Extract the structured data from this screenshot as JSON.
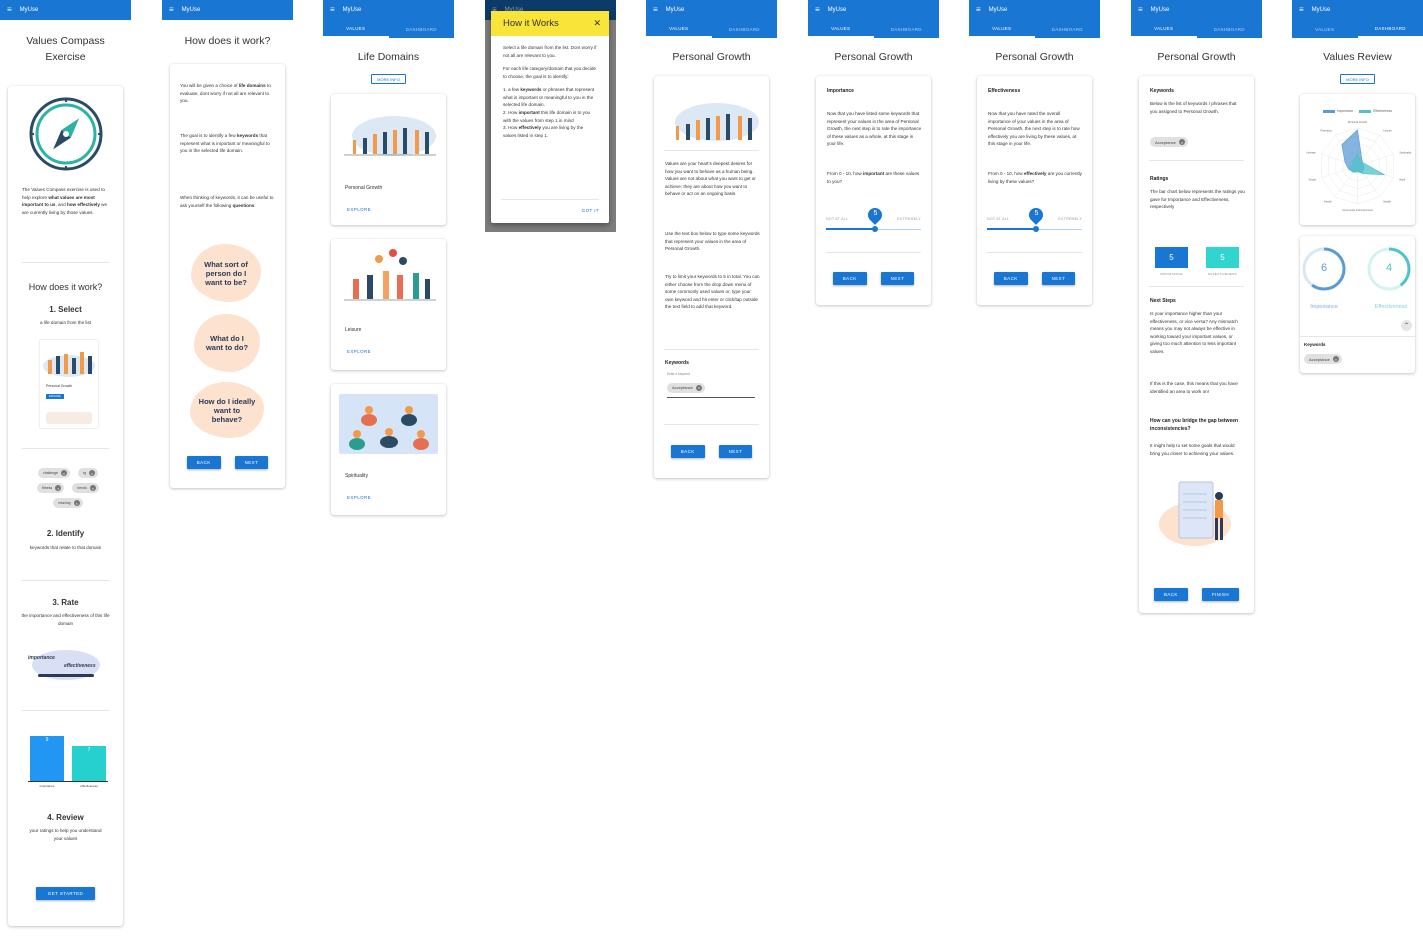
{
  "app": {
    "name": "MyUse",
    "tab_values": "Values",
    "tab_dashboard": "Dashboard"
  },
  "s1": {
    "title": "Values Compass Exercise",
    "intro_a": "The Values Compass exercise is used to help explore ",
    "intro_b": "what values are most important to us",
    "intro_c": ", and ",
    "intro_d": "how effectively",
    "intro_e": " we are currently living by those values.",
    "how_title": "How does it work?",
    "step1_title": "1. Select",
    "step1_text": "a life domain from the list",
    "thumb_label": "Personal Growth",
    "thumb_btn": "EXPLORE",
    "chips": [
      "challenge",
      "rg",
      "fitness",
      "riends",
      "relaxing"
    ],
    "step2_title": "2. Identify",
    "step2_text": "keywords that relate to that domain",
    "step3_title": "3. Rate",
    "step3_text": "the importance and effectiveness of this life domain",
    "scale_importance": "importance",
    "scale_effectiveness": "effectiveness",
    "mini_chart": {
      "bars": [
        {
          "label": "importance",
          "value": 9
        },
        {
          "label": "effectiveness",
          "value": 7
        }
      ]
    },
    "step4_title": "4. Review",
    "step4_text": "your ratings to help you understand your values",
    "get_started": "Get Started"
  },
  "s2": {
    "title": "How does it work?",
    "p1_a": "You will be given a choice of ",
    "p1_b": "life domains",
    "p1_c": " to evaluate, dont worry if not all are relevant to you.",
    "p2_a": "The goal is to identify a few ",
    "p2_b": "keywords",
    "p2_c": " that represent what is important or meaningful to you in the selected life domain.",
    "p3_a": "When thinking of keywords, it can be useful to ask yourself the following ",
    "p3_b": "questions",
    "p3_c": ":",
    "q1": "What sort of person do I want to be?",
    "q2": "What do I want to do?",
    "q3": "How do I ideally want to behave?",
    "back": "Back",
    "next": "Next"
  },
  "s3": {
    "title": "Life Domains",
    "more_info": "More Info",
    "cards": [
      {
        "label": "Personal Growth",
        "action": "Explore"
      },
      {
        "label": "Leisure",
        "action": "Explore"
      },
      {
        "label": "Spirituality",
        "action": "Explore"
      }
    ]
  },
  "s4": {
    "dialog_title": "How it Works",
    "close": "✕",
    "p1": "Select a life domain from the list. Dont worry if not all are relevant to you.",
    "p2": "For each life category/domain that you decide to choose, the goal is to identify:",
    "l1_a": "1. a few ",
    "l1_b": "keywords",
    "l1_c": " or phrases that represent what is important or meaningful to you in the selected life domain.",
    "l2_a": "2. How ",
    "l2_b": "important",
    "l2_c": " this life domain is to you with the values from step 1 in mind",
    "l3_a": "3. How ",
    "l3_b": "effectively",
    "l3_c": " you are living by the values listed in step 1.",
    "got_it": "Got it"
  },
  "s5": {
    "title": "Personal Growth",
    "p1": "Values are your heart's deepest desires for how you want to behave as a human being. Values are not about what you want to get or achieve; they are about how you want to behave or act on an ongoing basis.",
    "p2": "Use the text box below to type some keywords that represent your values in the area of Personal Growth.",
    "p3": "Try to limit your keywords to 5 in total. You can either choose from the drop down menu of some commonly used values or, type your own keyword and hit enter or click/tap outside the text field to add that keyword.",
    "keywords_label": "Keywords",
    "input_label": "Enter a keyword",
    "chip": "Acceptance",
    "back": "Back",
    "next": "Next"
  },
  "s6": {
    "title": "Personal Growth",
    "heading": "Importance",
    "p1": "Now that you have listed some keywords that represent your values in the area of Personal Growth, the next step is to rate the importance of these values as a whole, at this stage in your life.",
    "p2_a": "From 0 - 10, how ",
    "p2_b": "important",
    "p2_c": " are these values to you?",
    "value": "5",
    "lo": "Not at all",
    "hi": "Extremely",
    "back": "Back",
    "next": "Next"
  },
  "s7": {
    "title": "Personal Growth",
    "heading": "Effectiveness",
    "p1": "Now that you have rated the overall importance of your values in the area of Personal Growth, the next step is to rate how effectively you are living by these values, at this stage in your life.",
    "p2_a": "From 0 - 10, how ",
    "p2_b": "effectively",
    "p2_c": " are you currently living by these values?",
    "value": "5",
    "lo": "Not at all",
    "hi": "Extremely",
    "back": "Back",
    "next": "Next"
  },
  "s8": {
    "title": "Personal Growth",
    "kw_heading": "Keywords",
    "kw_text": "Below is the list of keywords / phrases that you assigned to Personal Growth.",
    "chip": "Acceptance",
    "ratings_heading": "Ratings",
    "ratings_text": "The bar chart below represents the ratings you gave for Importance and Effectiveness, respectively",
    "imp_value": "5",
    "imp_label": "Importance",
    "eff_value": "5",
    "eff_label": "Effectiveness",
    "next_heading": "Next Steps",
    "next_text": "Is your importance higher than your effectiveness, or vice versa? Any mismatch means you may not always be effective in working toward your important values, or giving too much attention to less important values.",
    "next_text2": "If this is the case, this means that you have identified an area to work on!",
    "bridge_heading": "How can you bridge the gap between inconsistencies?",
    "bridge_text": "It might help to set some goals that would bring you closer to achieving your values.",
    "back": "Back",
    "finish": "Finish"
  },
  "s9": {
    "title": "Values Review",
    "more_info": "More Info",
    "legend_imp": "Importance",
    "legend_eff": "Effectiveness",
    "radar_axes": [
      "Personal Growth",
      "Leisure",
      "Spirituality",
      "Work",
      "Health",
      "Community & Environment",
      "Family",
      "Social",
      "Intimate",
      "Parenting"
    ],
    "imp_value": "6",
    "imp_label": "Importance",
    "eff_value": "4",
    "eff_label": "Effectiveness",
    "kw_heading": "Keywords",
    "chip": "Acceptance",
    "colors": {
      "importance": "#5b9bd5",
      "effectiveness": "#4fc3c8"
    }
  }
}
